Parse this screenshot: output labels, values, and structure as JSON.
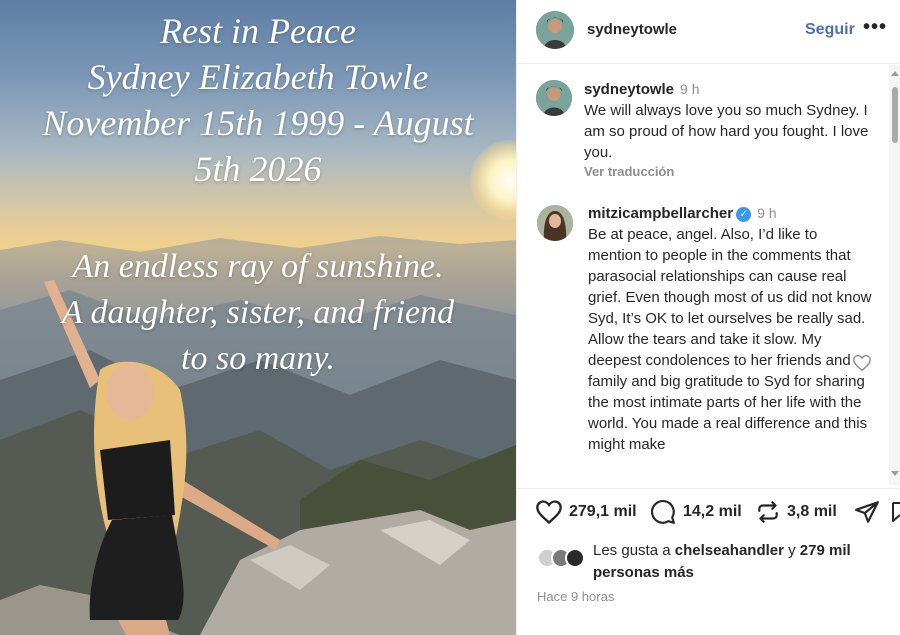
{
  "photo": {
    "headline_lines": [
      "Rest in Peace",
      "Sydney Elizabeth Towle",
      "November 15th 1999 - August",
      "5th 2026"
    ],
    "tagline_lines": [
      "An endless ray of sunshine.",
      "A daughter, sister, and friend",
      "to so many."
    ]
  },
  "header": {
    "username": "sydneytowle",
    "follow_label": "Seguir",
    "more_label": "•••"
  },
  "comments": [
    {
      "username": "sydneytowle",
      "time": "9 h",
      "text": "We will always love you so much Sydney. I am so proud of how hard you fought. I love you.",
      "translate_label": "Ver traducción"
    },
    {
      "username": "mitzicampbellarcher",
      "verified": true,
      "time": "9 h",
      "text": "Be at peace, angel. Also, I’d like to mention to people in the comments that parasocial relationships can cause real grief. Even though most of us did not know Syd, It’s OK to let ourselves be really sad. Allow the tears and take it slow. My deepest condolences to her friends and family and big gratitude to Syd for sharing the most intimate parts of her life with the world. You made a real difference and this might make"
    }
  ],
  "actions": {
    "likes": "279,1 mil",
    "comments": "14,2 mil",
    "reposts": "3,8 mil"
  },
  "likes_summary": {
    "prefix": "Les gusta a ",
    "user": "chelseahandler",
    "middle": " y ",
    "count": "279 mil",
    "suffix": "personas más"
  },
  "timestamp": "Hace 9 horas",
  "colors": {
    "follow": "#4a6fb5",
    "verified": "#3897f0"
  }
}
